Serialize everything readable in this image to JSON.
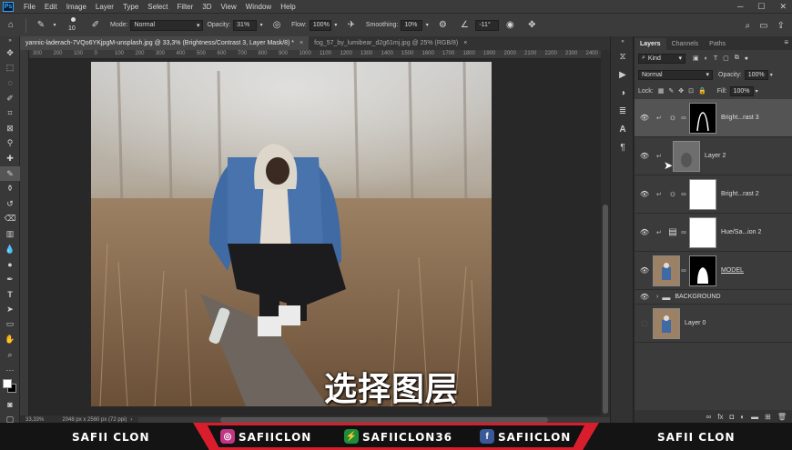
{
  "menu": [
    "File",
    "Edit",
    "Image",
    "Layer",
    "Type",
    "Select",
    "Filter",
    "3D",
    "View",
    "Window",
    "Help"
  ],
  "options": {
    "brush_size": "10",
    "mode_label": "Mode:",
    "mode_value": "Normal",
    "opacity_label": "Opacity:",
    "opacity_value": "31%",
    "flow_label": "Flow:",
    "flow_value": "100%",
    "smoothing_label": "Smoothing:",
    "smoothing_value": "10%",
    "angle_value": "-11°"
  },
  "tabs": [
    {
      "label": "yannic-laderach-7VQo6YKjpgM-unsplash.jpg @ 33,3% (Brightness/Contrast 3, Layer Mask/8) *",
      "close": "×"
    },
    {
      "label": "fog_57_by_lumibear_d2g61mj.jpg @ 25% (RGB/8)",
      "close": "×"
    }
  ],
  "ruler_ticks": [
    "300",
    "200",
    "100",
    "0",
    "100",
    "200",
    "300",
    "400",
    "500",
    "600",
    "700",
    "800",
    "900",
    "1000",
    "1100",
    "1200",
    "1300",
    "1400",
    "1500",
    "1600",
    "1700",
    "1800",
    "1900",
    "2000",
    "2100",
    "2200",
    "2300",
    "2400"
  ],
  "canvas": {
    "subtitle": "选择图层"
  },
  "status": {
    "zoom": "33,33%",
    "dims": "2048 px x 2560 px (72 ppi)"
  },
  "layers_panel": {
    "tabs": [
      "Layers",
      "Channels",
      "Paths"
    ],
    "filter_kind": "Kind",
    "blend_mode": "Normal",
    "opacity_label": "Opacity:",
    "opacity_value": "100%",
    "lock_label": "Lock:",
    "fill_label": "Fill:",
    "fill_value": "100%",
    "layers": [
      {
        "name": "Bright...rast 3"
      },
      {
        "name": "Layer 2"
      },
      {
        "name": "Bright...rast 2"
      },
      {
        "name": "Hue/Sa...ion 2"
      },
      {
        "name": "MODEL"
      },
      {
        "name": "BACKGROUND"
      },
      {
        "name": "Layer 0"
      }
    ]
  },
  "banner": {
    "left": "SAFII CLON",
    "instagram": "SAFIICLON",
    "other": "SAFIICLON36",
    "facebook": "SAFIICLON",
    "right": "SAFII CLON"
  }
}
